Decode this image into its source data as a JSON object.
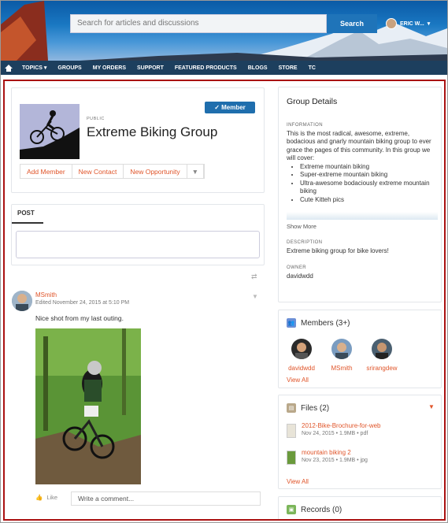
{
  "header": {
    "search_placeholder": "Search for articles and discussions",
    "search_button": "Search",
    "user_name": "ERIC W..."
  },
  "nav": {
    "items": [
      "TOPICS ▾",
      "GROUPS",
      "MY ORDERS",
      "SUPPORT",
      "FEATURED PRODUCTS",
      "BLOGS",
      "STORE",
      "TC"
    ]
  },
  "group": {
    "visibility": "PUBLIC",
    "title": "Extreme Biking Group",
    "member_button": "✓ Member",
    "actions": [
      "Add Member",
      "New Contact",
      "New Opportunity"
    ]
  },
  "publisher": {
    "tab": "POST"
  },
  "feed": {
    "author": "MSmith",
    "date": "Edited November 24, 2015 at 5:10 PM",
    "text": "Nice shot from my last outing.",
    "like": "Like",
    "comment_placeholder": "Write a comment..."
  },
  "details": {
    "title": "Group Details",
    "info_label": "INFORMATION",
    "info_text": "This is the most radical, awesome, extreme, bodacious and gnarly mountain biking group to ever grace the pages of this community. In this group we will cover:",
    "info_items": [
      "Extreme mountain biking",
      "Super-extreme mountain biking",
      "Ultra-awesome bodaciously extreme mountain biking",
      "Cute Kitteh pics"
    ],
    "show_more": "Show More",
    "desc_label": "DESCRIPTION",
    "desc_text": "Extreme biking group for bike lovers!",
    "owner_label": "OWNER",
    "owner": "davidwdd"
  },
  "members": {
    "title": "Members (3+)",
    "list": [
      "davidwdd",
      "MSmith",
      "srirangdew"
    ],
    "view_all": "View All"
  },
  "files": {
    "title": "Files (2)",
    "items": [
      {
        "name": "2012-Bike-Brochure-for-web",
        "meta": "Nov 24, 2015 • 1.9MB • pdf"
      },
      {
        "name": "mountain biking 2",
        "meta": "Nov 23, 2015 • 1.9MB • jpg"
      }
    ],
    "view_all": "View All"
  },
  "records": {
    "title": "Records (0)"
  },
  "colors": {
    "accent": "#e0552a",
    "brand_blue": "#1f6ead",
    "nav_bg": "#1d3f5e",
    "border_highlight": "#aa1111"
  }
}
